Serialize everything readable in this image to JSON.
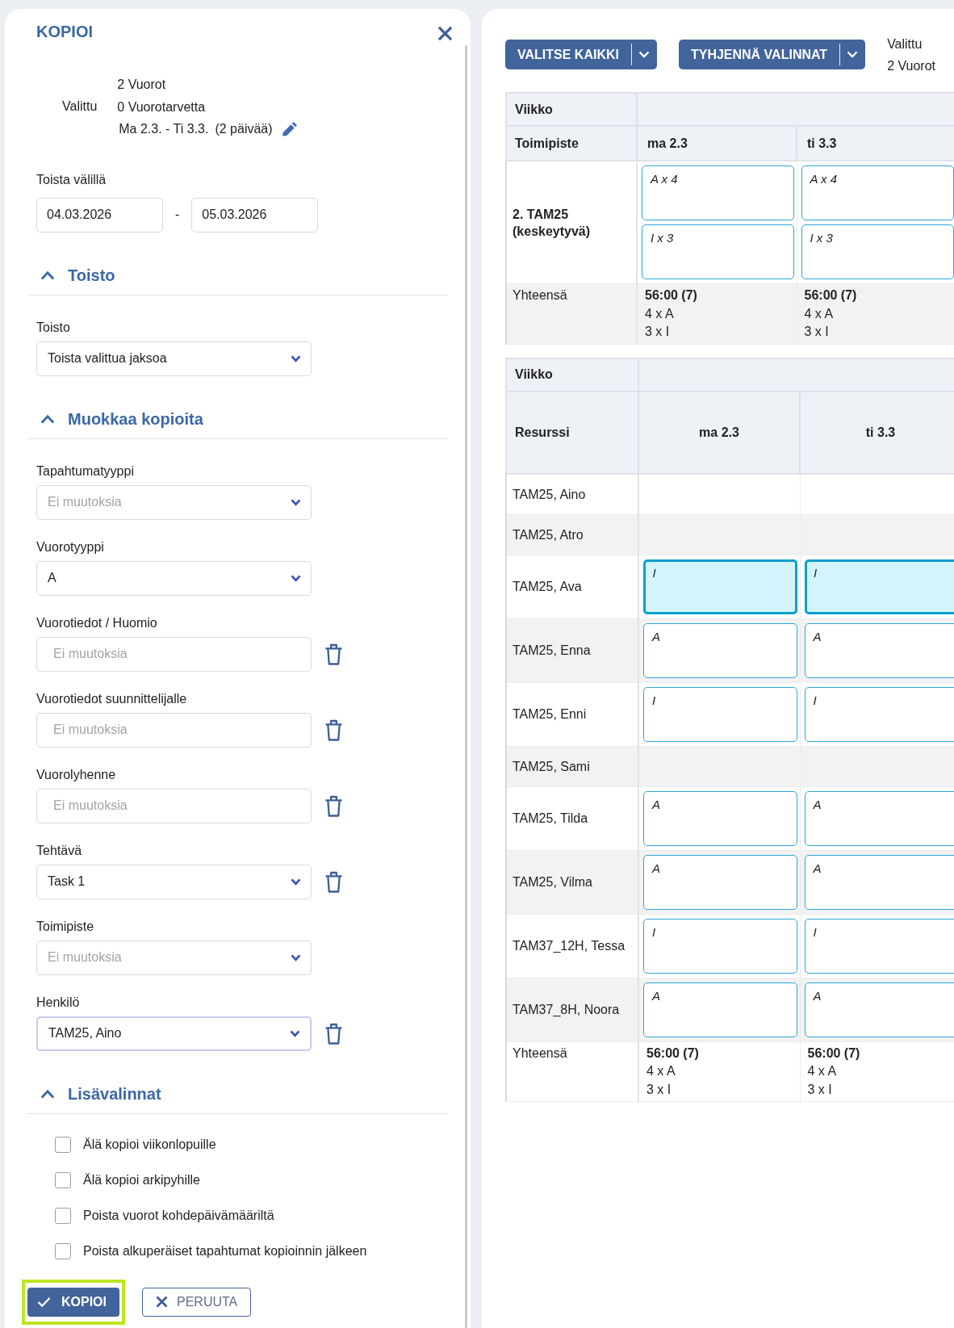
{
  "copy_panel": {
    "title": "KOPIOI",
    "selection": {
      "label": "Valittu",
      "lines": [
        "2 Vuorot",
        "0 Vuorotarvetta"
      ],
      "range": "Ma 2.3. - Ti 3.3.",
      "days": "(2 päivää)"
    },
    "repeat_between": {
      "label": "Toista välillä",
      "start": "04.03.2026",
      "separator": "-",
      "end": "05.03.2026"
    },
    "sections": [
      {
        "title": "Toisto",
        "expanded": true,
        "fields": [
          {
            "label": "Toisto",
            "kind": "select",
            "value": "Toista valittua jaksoa",
            "clearable": false,
            "focused": false
          }
        ]
      },
      {
        "title": "Muokkaa kopioita",
        "expanded": true,
        "fields": [
          {
            "label": "Tapahtumatyyppi",
            "kind": "select",
            "placeholder": "Ei muutoksia",
            "clearable": false,
            "focused": false
          },
          {
            "label": "Vuorotyyppi",
            "kind": "select",
            "value": "A",
            "clearable": false,
            "focused": false
          },
          {
            "label": "Vuorotiedot / Huomio",
            "kind": "text",
            "placeholder": "Ei muutoksia",
            "clearable": true,
            "focused": false
          },
          {
            "label": "Vuorotiedot suunnittelijalle",
            "kind": "text",
            "placeholder": "Ei muutoksia",
            "clearable": true,
            "focused": false
          },
          {
            "label": "Vuorolyhenne",
            "kind": "text",
            "placeholder": "Ei muutoksia",
            "clearable": true,
            "focused": false
          },
          {
            "label": "Tehtävä",
            "kind": "select",
            "value": "Task 1",
            "clearable": true,
            "focused": false
          },
          {
            "label": "Toimipiste",
            "kind": "select",
            "placeholder": "Ei muutoksia",
            "clearable": false,
            "focused": false
          },
          {
            "label": "Henkilö",
            "kind": "select",
            "value": "TAM25, Aino",
            "clearable": true,
            "focused": true
          }
        ]
      },
      {
        "title": "Lisävalinnat",
        "expanded": true,
        "options": [
          {
            "label": "Älä kopioi viikonlopuille",
            "checked": false
          },
          {
            "label": "Älä kopioi arkipyhille",
            "checked": false
          },
          {
            "label": "Poista vuorot kohdepäivämääriltä",
            "checked": false
          },
          {
            "label": "Poista alkuperäiset tapahtumat kopioinnin jälkeen",
            "checked": false
          }
        ]
      }
    ],
    "buttons": [
      {
        "label": "KOPIOI",
        "kind": "primary",
        "highlighted": true
      },
      {
        "label": "PERUUTA",
        "kind": "secondary",
        "highlighted": false
      }
    ]
  },
  "schedule": {
    "toolbar": [
      {
        "label": "VALITSE KAIKKI"
      },
      {
        "label": "TYHJENNÄ VALINNAT"
      }
    ],
    "selection": {
      "label": "Valittu",
      "value": "2 Vuorot"
    },
    "location_table": {
      "week_label": "Viikko",
      "header": "Toimipiste",
      "days": [
        "ma 2.3",
        "ti 3.3"
      ],
      "rows": [
        {
          "name": "2. TAM25 (keskeytyvä)",
          "cells": [
            {
              "shifts": [
                {
                  "label": "A x 4",
                  "selected": false
                },
                {
                  "label": "I x 3",
                  "selected": false
                }
              ]
            },
            {
              "shifts": [
                {
                  "label": "A x 4",
                  "selected": false
                },
                {
                  "label": "I x 3",
                  "selected": false
                }
              ]
            }
          ]
        }
      ],
      "totals": {
        "label": "Yhteensä",
        "cells": [
          {
            "hours": "56:00 (7)",
            "lines": [
              "4 x A",
              "3 x I"
            ]
          },
          {
            "hours": "56:00 (7)",
            "lines": [
              "4 x A",
              "3 x I"
            ]
          }
        ]
      }
    },
    "resource_table": {
      "week_label": "Viikko",
      "header": "Resurssi",
      "days": [
        "ma 2.3",
        "ti 3.3"
      ],
      "rows": [
        {
          "name": "TAM25, Aino"
        },
        {
          "name": "TAM25, Atro"
        },
        {
          "name": "TAM25, Ava",
          "cells": [
            {
              "shifts": [
                {
                  "label": "I",
                  "selected": true
                }
              ]
            },
            {
              "shifts": [
                {
                  "label": "I",
                  "selected": true
                }
              ]
            }
          ]
        },
        {
          "name": "TAM25, Enna",
          "cells": [
            {
              "shifts": [
                {
                  "label": "A",
                  "selected": false
                }
              ]
            },
            {
              "shifts": [
                {
                  "label": "A",
                  "selected": false
                }
              ]
            }
          ]
        },
        {
          "name": "TAM25, Enni",
          "cells": [
            {
              "shifts": [
                {
                  "label": "I",
                  "selected": false
                }
              ]
            },
            {
              "shifts": [
                {
                  "label": "I",
                  "selected": false
                }
              ]
            }
          ]
        },
        {
          "name": "TAM25, Sami"
        },
        {
          "name": "TAM25, Tilda",
          "cells": [
            {
              "shifts": [
                {
                  "label": "A",
                  "selected": false
                }
              ]
            },
            {
              "shifts": [
                {
                  "label": "A",
                  "selected": false
                }
              ]
            }
          ]
        },
        {
          "name": "TAM25, Vilma",
          "cells": [
            {
              "shifts": [
                {
                  "label": "A",
                  "selected": false
                }
              ]
            },
            {
              "shifts": [
                {
                  "label": "A",
                  "selected": false
                }
              ]
            }
          ]
        },
        {
          "name": "TAM37_12H, Tessa",
          "cells": [
            {
              "shifts": [
                {
                  "label": "I",
                  "selected": false
                }
              ]
            },
            {
              "shifts": [
                {
                  "label": "I",
                  "selected": false
                }
              ]
            }
          ]
        },
        {
          "name": "TAM37_8H, Noora",
          "cells": [
            {
              "shifts": [
                {
                  "label": "A",
                  "selected": false
                }
              ]
            },
            {
              "shifts": [
                {
                  "label": "A",
                  "selected": false
                }
              ]
            }
          ]
        }
      ],
      "totals": {
        "label": "Yhteensä",
        "cells": [
          {
            "hours": "56:00 (7)",
            "lines": [
              "4 x A",
              "3 x I"
            ]
          },
          {
            "hours": "56:00 (7)",
            "lines": [
              "4 x A",
              "3 x I"
            ]
          }
        ]
      }
    }
  }
}
